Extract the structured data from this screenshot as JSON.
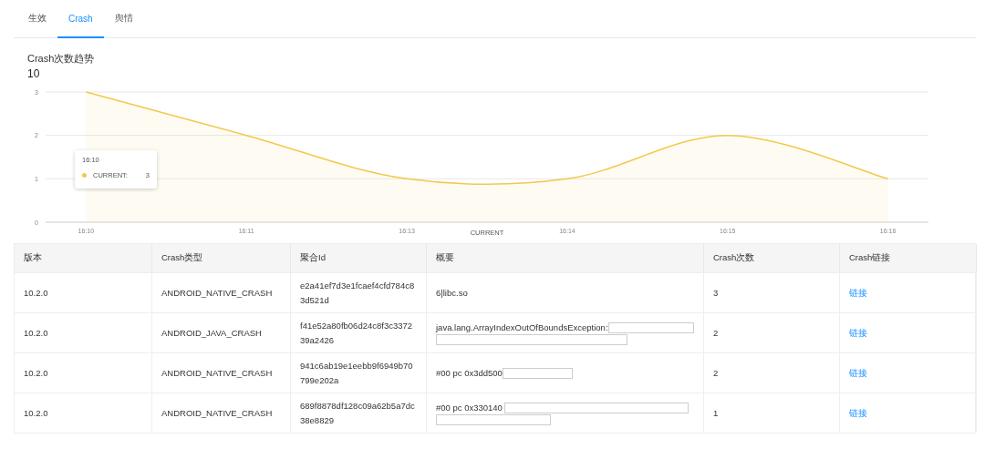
{
  "tabs": [
    {
      "label": "生效",
      "selected": false
    },
    {
      "label": "Crash",
      "selected": true
    },
    {
      "label": "舆情",
      "selected": false
    }
  ],
  "chart_panel": {
    "title": "Crash次数趋势",
    "total": "10",
    "chart_data": {
      "type": "area",
      "categories": [
        "16:10",
        "16:11",
        "16:13",
        "16:14",
        "16:15",
        "16:16"
      ],
      "ylim": [
        0,
        3
      ],
      "yticks": [
        {
          "value": 0,
          "label": "0"
        },
        {
          "value": 1,
          "label": "1"
        },
        {
          "value": 2,
          "label": "2"
        },
        {
          "value": 3,
          "label": "3"
        }
      ],
      "series": [
        {
          "name": "CURRENT",
          "color": "#f2c94c",
          "values": [
            3,
            2,
            1,
            1,
            2,
            1
          ]
        }
      ]
    },
    "tooltip": {
      "title": "16:10",
      "series_name": "CURRENT:",
      "value": "3"
    }
  },
  "table": {
    "columns": [
      "版本",
      "Crash类型",
      "聚合Id",
      "概要",
      "Crash次数",
      "Crash链接"
    ],
    "rows": [
      {
        "version": "10.2.0",
        "type": "ANDROID_NATIVE_CRASH",
        "id": "e2a41ef7d3e1fcaef4cfd784c83d521d",
        "summary": "6|libc.so",
        "kind": "plain",
        "count": "3",
        "link": "链接"
      },
      {
        "version": "10.2.0",
        "type": "ANDROID_JAVA_CRASH",
        "id": "f41e52a80fb06d24c8f3c337239a2426",
        "summary": "java.lang.ArrayIndexOutOfBoundsException:",
        "kind": "wrap",
        "count": "2",
        "link": "链接"
      },
      {
        "version": "10.2.0",
        "type": "ANDROID_NATIVE_CRASH",
        "id": "941c6ab19e1eebb9f6949b70799e202a",
        "summary": "#00 pc 0x3dd500",
        "kind": "inline",
        "count": "2",
        "link": "链接"
      },
      {
        "version": "10.2.0",
        "type": "ANDROID_NATIVE_CRASH",
        "id": "689f8878df128c09a62b5a7dc38e8829",
        "summary": "#00 pc 0x330140",
        "kind": "wraplong",
        "count": "1",
        "link": "链接"
      }
    ]
  }
}
